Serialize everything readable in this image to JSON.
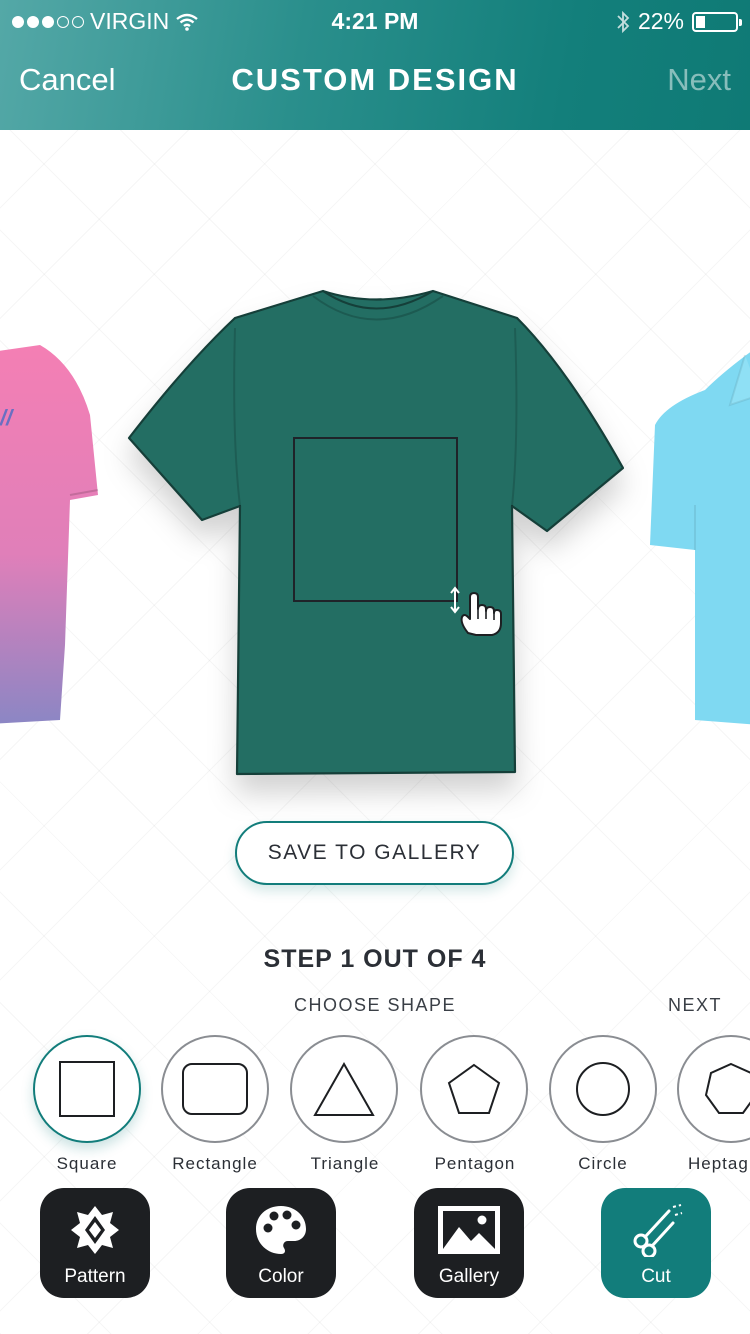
{
  "status_bar": {
    "carrier": "VIRGIN",
    "time": "4:21 PM",
    "battery": "22%"
  },
  "nav": {
    "cancel": "Cancel",
    "title": "CUSTOM DESIGN",
    "next": "Next"
  },
  "colors": {
    "accent": "#127d7b",
    "shirt": "#236e63",
    "left_shirt": "#f47fb4",
    "right_shirt": "#7fd9f2",
    "tool_bg": "#1d1f22"
  },
  "save_button": "SAVE TO GALLERY",
  "step": {
    "title": "STEP 1 OUT OF 4",
    "subtitle": "CHOOSE SHAPE",
    "next": "NEXT"
  },
  "shapes": [
    {
      "label": "Square",
      "icon": "square-icon",
      "selected": true
    },
    {
      "label": "Rectangle",
      "icon": "rounded-rectangle-icon",
      "selected": false
    },
    {
      "label": "Triangle",
      "icon": "triangle-icon",
      "selected": false
    },
    {
      "label": "Pentagon",
      "icon": "pentagon-icon",
      "selected": false
    },
    {
      "label": "Circle",
      "icon": "circle-icon",
      "selected": false
    },
    {
      "label": "Heptag",
      "icon": "heptagon-icon",
      "selected": false
    }
  ],
  "tools": [
    {
      "label": "Pattern",
      "icon": "pattern-icon",
      "active": false
    },
    {
      "label": "Color",
      "icon": "palette-icon",
      "active": false
    },
    {
      "label": "Gallery",
      "icon": "image-icon",
      "active": false
    },
    {
      "label": "Cut",
      "icon": "scissors-icon",
      "active": true
    }
  ]
}
